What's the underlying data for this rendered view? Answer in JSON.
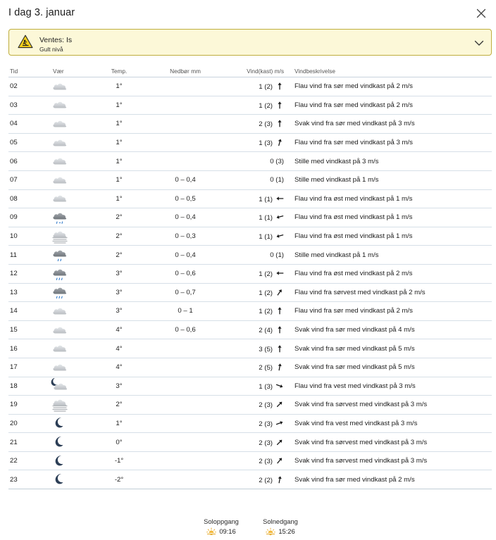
{
  "header": {
    "title": "I dag 3. januar"
  },
  "warning": {
    "title": "Ventes: Is",
    "level": "Gult nivå"
  },
  "table": {
    "headers": {
      "time": "Tid",
      "symbol": "Vær",
      "temp": "Temp.",
      "precip": "Nedbør mm",
      "wind": "Vind(kast) m/s",
      "desc": "Vindbeskrivelse"
    },
    "rows": [
      {
        "time": "02",
        "symbol": "cloud-icon",
        "temp": "1°",
        "tempClass": "warm",
        "precip": "",
        "wind": "1 (2)",
        "dir": 0,
        "desc": "Flau vind fra sør med vindkast på 2 m/s"
      },
      {
        "time": "03",
        "symbol": "cloud-icon",
        "temp": "1°",
        "tempClass": "warm",
        "precip": "",
        "wind": "1 (2)",
        "dir": 0,
        "desc": "Flau vind fra sør med vindkast på 2 m/s"
      },
      {
        "time": "04",
        "symbol": "cloud-icon",
        "temp": "1°",
        "tempClass": "warm",
        "precip": "",
        "wind": "2 (3)",
        "dir": 0,
        "desc": "Svak vind fra sør med vindkast på 3 m/s"
      },
      {
        "time": "05",
        "symbol": "cloud-icon",
        "temp": "1°",
        "tempClass": "warm",
        "precip": "",
        "wind": "1 (3)",
        "dir": 15,
        "desc": "Flau vind fra sør med vindkast på 3 m/s"
      },
      {
        "time": "06",
        "symbol": "cloud-icon",
        "temp": "1°",
        "tempClass": "warm",
        "precip": "",
        "wind": "0 (3)",
        "dir": null,
        "desc": "Stille med vindkast på 3 m/s"
      },
      {
        "time": "07",
        "symbol": "cloud-icon",
        "temp": "1°",
        "tempClass": "warm",
        "precip": "0 – 0,4",
        "wind": "0 (1)",
        "dir": null,
        "desc": "Stille med vindkast på 1 m/s"
      },
      {
        "time": "08",
        "symbol": "cloud-icon",
        "temp": "1°",
        "tempClass": "warm",
        "precip": "0 – 0,5",
        "wind": "1 (1)",
        "dir": 270,
        "desc": "Flau vind fra øst med vindkast på 1 m/s"
      },
      {
        "time": "09",
        "symbol": "sleet-icon",
        "temp": "2°",
        "tempClass": "warm",
        "precip": "0 – 0,4",
        "wind": "1 (1)",
        "dir": 255,
        "desc": "Flau vind fra øst med vindkast på 1 m/s"
      },
      {
        "time": "10",
        "symbol": "fog-icon",
        "temp": "2°",
        "tempClass": "warm",
        "precip": "0 – 0,3",
        "wind": "1 (1)",
        "dir": 255,
        "desc": "Flau vind fra øst med vindkast på 1 m/s"
      },
      {
        "time": "11",
        "symbol": "drizzle-icon",
        "temp": "2°",
        "tempClass": "warm",
        "precip": "0 – 0,4",
        "wind": "0 (1)",
        "dir": null,
        "desc": "Stille med vindkast på 1 m/s"
      },
      {
        "time": "12",
        "symbol": "rain-icon",
        "temp": "3°",
        "tempClass": "warm",
        "precip": "0 – 0,6",
        "wind": "1 (2)",
        "dir": 270,
        "desc": "Flau vind fra øst med vindkast på 2 m/s"
      },
      {
        "time": "13",
        "symbol": "rain-icon",
        "temp": "3°",
        "tempClass": "warm",
        "precip": "0 – 0,7",
        "wind": "1 (2)",
        "dir": 35,
        "desc": "Flau vind fra sørvest med vindkast på 2 m/s"
      },
      {
        "time": "14",
        "symbol": "cloud-icon",
        "temp": "3°",
        "tempClass": "warm",
        "precip": "0 – 1",
        "wind": "1 (2)",
        "dir": 0,
        "desc": "Flau vind fra sør med vindkast på 2 m/s"
      },
      {
        "time": "15",
        "symbol": "cloud-icon",
        "temp": "4°",
        "tempClass": "warm",
        "precip": "0 – 0,6",
        "wind": "2 (4)",
        "dir": 0,
        "desc": "Svak vind fra sør med vindkast på 4 m/s"
      },
      {
        "time": "16",
        "symbol": "cloud-icon",
        "temp": "4°",
        "tempClass": "warm",
        "precip": "",
        "wind": "3 (5)",
        "dir": 0,
        "desc": "Svak vind fra sør med vindkast på 5 m/s"
      },
      {
        "time": "17",
        "symbol": "cloud-icon",
        "temp": "4°",
        "tempClass": "warm",
        "precip": "",
        "wind": "2 (5)",
        "dir": 10,
        "desc": "Svak vind fra sør med vindkast på 5 m/s"
      },
      {
        "time": "18",
        "symbol": "partly-cloudy-night-icon",
        "temp": "3°",
        "tempClass": "warm",
        "precip": "",
        "wind": "1 (3)",
        "dir": 110,
        "desc": "Flau vind fra vest med vindkast på 3 m/s"
      },
      {
        "time": "19",
        "symbol": "fog-icon",
        "temp": "2°",
        "tempClass": "warm",
        "precip": "",
        "wind": "2 (3)",
        "dir": 45,
        "desc": "Svak vind fra sørvest med vindkast på 3 m/s"
      },
      {
        "time": "20",
        "symbol": "moon-icon",
        "temp": "1°",
        "tempClass": "warm",
        "precip": "",
        "wind": "2 (3)",
        "dir": 70,
        "desc": "Svak vind fra vest med vindkast på 3 m/s"
      },
      {
        "time": "21",
        "symbol": "moon-icon",
        "temp": "0°",
        "tempClass": "cold",
        "precip": "",
        "wind": "2 (3)",
        "dir": 45,
        "desc": "Svak vind fra sørvest med vindkast på 3 m/s"
      },
      {
        "time": "22",
        "symbol": "moon-icon",
        "temp": "-1°",
        "tempClass": "cold",
        "precip": "",
        "wind": "2 (3)",
        "dir": 40,
        "desc": "Svak vind fra sørvest med vindkast på 3 m/s"
      },
      {
        "time": "23",
        "symbol": "moon-icon",
        "temp": "-2°",
        "tempClass": "cold",
        "precip": "",
        "wind": "2 (2)",
        "dir": 10,
        "desc": "Svak vind fra sør med vindkast på 2 m/s"
      }
    ]
  },
  "sun": {
    "rise_label": "Soloppgang",
    "rise_time": "09:16",
    "set_label": "Solnedgang",
    "set_time": "15:26"
  },
  "colors": {
    "warning_bg": "#fcf8d8",
    "warning_border": "#bfae3e",
    "temp_warm": "#c6262e",
    "temp_cold": "#1f6bbf",
    "precip": "#1f6bbf"
  }
}
